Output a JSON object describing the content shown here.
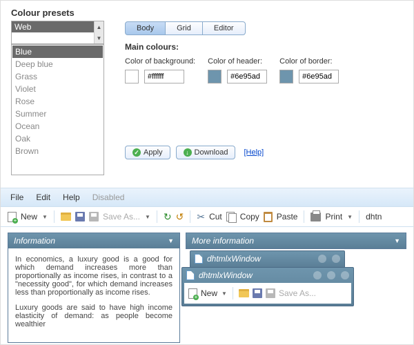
{
  "title": "Colour presets",
  "preset_dropdown": {
    "selected": "Web"
  },
  "presets": [
    "Blue",
    "Deep blue",
    "Grass",
    "Violet",
    "Rose",
    "Summer",
    "Ocean",
    "Oak",
    "Brown"
  ],
  "preset_selected_index": 0,
  "tabs": [
    {
      "label": "Body",
      "active": true
    },
    {
      "label": "Grid",
      "active": false
    },
    {
      "label": "Editor",
      "active": false
    }
  ],
  "main_colours_label": "Main colours:",
  "colours": [
    {
      "label": "Color of background:",
      "value": "#ffffff",
      "swatch": "#ffffff"
    },
    {
      "label": "Color of header:",
      "value": "#6e95ad",
      "swatch": "#6e95ad"
    },
    {
      "label": "Color of border:",
      "value": "#6e95ad",
      "swatch": "#6e95ad"
    }
  ],
  "actions": {
    "apply": "Apply",
    "download": "Download",
    "help": "[Help]"
  },
  "menu": {
    "file": "File",
    "edit": "Edit",
    "help": "Help",
    "disabled": "Disabled"
  },
  "toolbar": {
    "new": "New",
    "save_as": "Save As...",
    "cut": "Cut",
    "copy": "Copy",
    "paste": "Paste",
    "print": "Print",
    "overflow": "dhtn"
  },
  "panels": {
    "info_title": "Information",
    "info_p1": "In economics, a luxury good is a good for which demand increases more than proportionally as income rises, in contrast to a \"necessity good\", for which demand increases less than proportionally as income rises.",
    "info_p2": "Luxury goods are said to have high income elasticity of demand: as people become wealthier",
    "more_info_title": "More information",
    "window_title": "dhtmlxWindow"
  },
  "new_btn": "New",
  "save_as2": "Save As..."
}
